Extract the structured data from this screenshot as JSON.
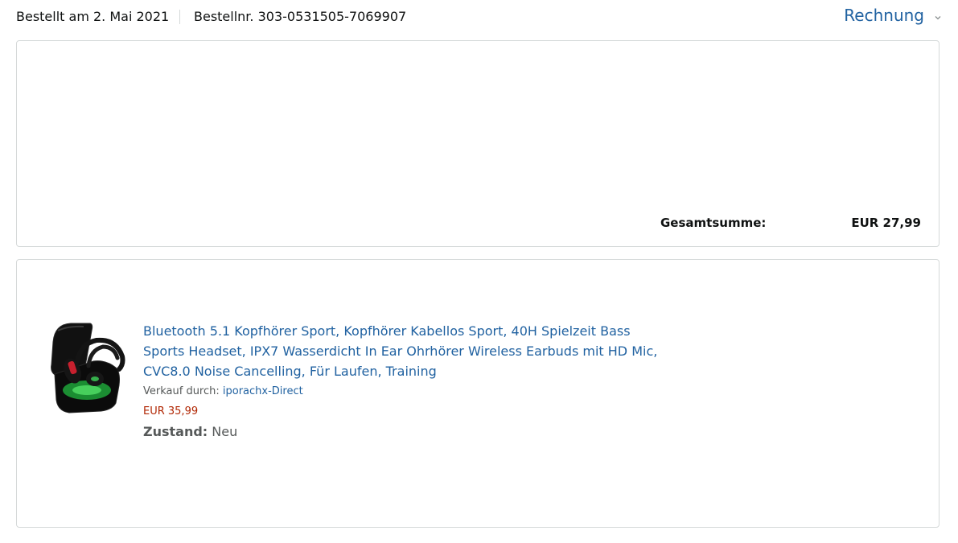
{
  "header": {
    "order_date": "Bestellt am 2. Mai 2021",
    "order_number": "Bestellnr. 303-0531505-7069907",
    "invoice_label": "Rechnung",
    "invoice_icon": "chevron-down-icon"
  },
  "summary": {
    "total_label": "Gesamtsumme:",
    "total_value": "EUR 27,99"
  },
  "item": {
    "image_icon": "earbuds-product-image",
    "title": "Bluetooth 5.1 Kopfhörer Sport, Kopfhörer Kabellos Sport, 40H Spielzeit Bass Sports Headset, IPX7 Wasserdicht In Ear Ohrhörer Wireless Earbuds mit HD Mic, CVC8.0 Noise Cancelling, Für Laufen, Training",
    "seller_prefix": "Verkauf durch: ",
    "seller_name": "iporachx-Direct",
    "price": "EUR 35,99",
    "condition_label": "Zustand:",
    "condition_value": " Neu"
  },
  "colors": {
    "link": "#2162a1",
    "price": "#b12704",
    "border": "#d5d9d9",
    "text": "#0f1111",
    "secondary_text": "#565959"
  }
}
